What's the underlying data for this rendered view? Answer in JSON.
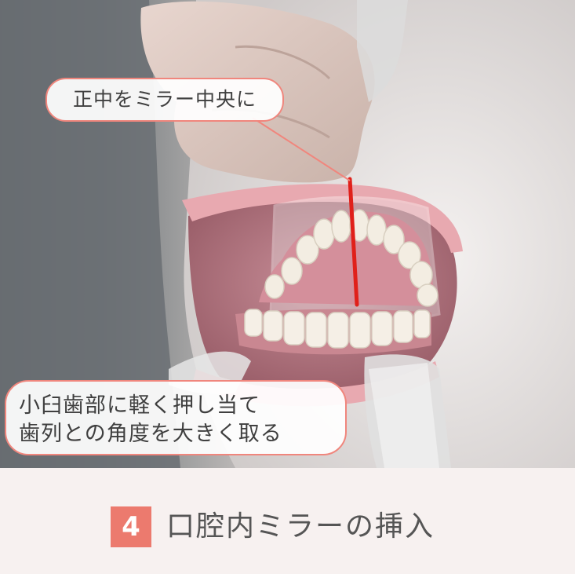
{
  "annotations": {
    "midline_label": "正中をミラー中央に",
    "premolar_label": {
      "line1": "小臼歯部に軽く押し当て",
      "line2": "歯列との角度を大きく取る"
    }
  },
  "caption": {
    "step_number": "4",
    "title": "口腔内ミラーの挿入"
  },
  "colors": {
    "accent": "#ec7a6e",
    "bubble_border": "#f0867d",
    "midline_marker": "#e0201a",
    "caption_text": "#555555",
    "background": "#f7f1f0"
  },
  "icons": {
    "photo": "intraoral-mirror-photo"
  }
}
